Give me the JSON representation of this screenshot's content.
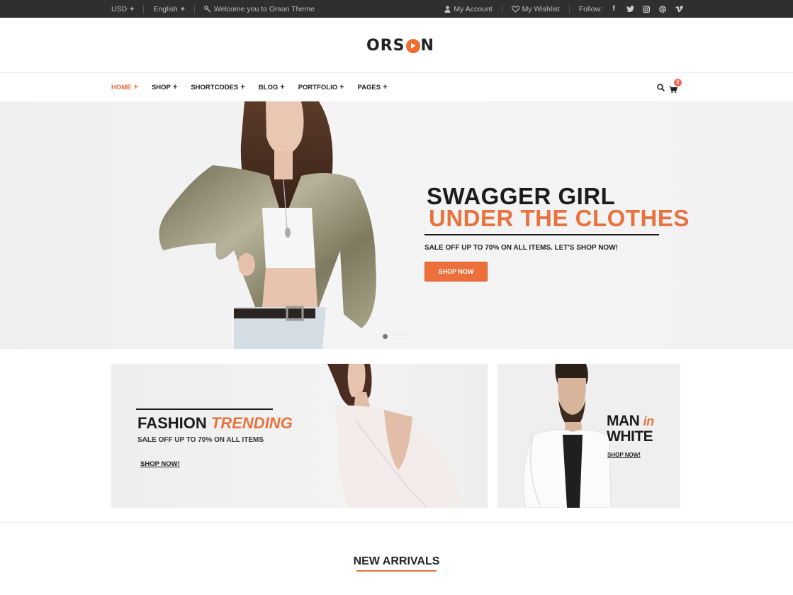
{
  "topbar": {
    "currency": "USD",
    "language": "English",
    "welcome": "Welcome you to Orson Theme",
    "my_account": "My Account",
    "my_wishlist": "My Wishlist",
    "follow_label": "Follow:",
    "social_icons": [
      "facebook-icon",
      "twitter-icon",
      "instagram-icon",
      "dribbble-icon",
      "vimeo-icon"
    ]
  },
  "logo": {
    "left": "ORS",
    "right": "N"
  },
  "nav": {
    "items": [
      {
        "label": "HOME",
        "active": true
      },
      {
        "label": "SHOP",
        "active": false
      },
      {
        "label": "SHORTCODES",
        "active": false
      },
      {
        "label": "BLOG",
        "active": false
      },
      {
        "label": "PORTFOLIO",
        "active": false
      },
      {
        "label": "PAGES",
        "active": false
      }
    ],
    "cart_count": "0"
  },
  "hero": {
    "title_line1": "SWAGGER GIRL",
    "title_line2": "UNDER THE CLOTHES",
    "subtitle": "SALE OFF UP TO 70% ON ALL ITEMS. LET'S SHOP NOW!",
    "button": "SHOP NOW",
    "slides": 3,
    "active_slide": 1
  },
  "banner_left": {
    "title_main": "FASHION",
    "title_accent": "TRENDING",
    "subtitle": "SALE OFF UP TO 70% ON ALL ITEMS",
    "link": "SHOP NOW!"
  },
  "banner_right": {
    "title_part1": "MAN",
    "title_accent": "in",
    "title_line2": "WHITE",
    "link": "SHOP NOW!"
  },
  "section_title": "NEW ARRIVALS",
  "colors": {
    "accent": "#e8733e",
    "topbar": "#2f2f2f",
    "badge": "#ec6c5a"
  }
}
